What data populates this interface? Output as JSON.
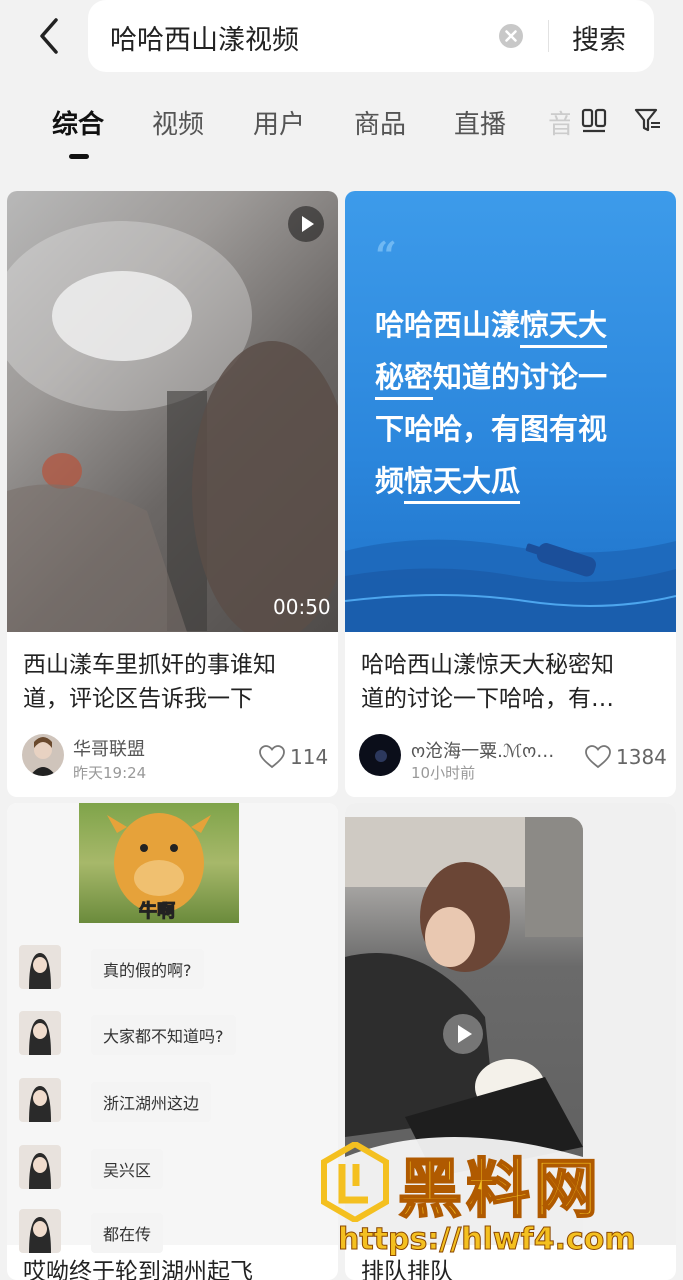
{
  "search": {
    "query": "哈哈西山漾视频",
    "button": "搜索"
  },
  "tabs": [
    "综合",
    "视频",
    "用户",
    "商品",
    "直播",
    "音"
  ],
  "cards": [
    {
      "title": "西山漾车里抓奸的事谁知道，评论区告诉我一下",
      "title_l1": "西山漾车里抓奸的事谁知",
      "title_l2": "道，评论区告诉我一下",
      "author": "华哥联盟",
      "time": "昨天19:24",
      "likes": "114",
      "duration": "00:50"
    },
    {
      "title_l1": "哈哈西山漾惊天大秘密知",
      "title_l2": "道的讨论一下哈哈，有…",
      "author": "ო沧海一粟.ℳო…",
      "time": "10小时前",
      "likes": "1384",
      "cover_lines": {
        "p1": "哈哈西山漾",
        "h1": "惊天大",
        "h2": "秘密",
        "p2": "知道的讨论一",
        "p3": "下哈哈，有图有视",
        "p4": "频",
        "h3": "惊天大瓜"
      }
    },
    {
      "title_l1": "哎呦终于轮到湖州起飞",
      "meme_caption": "牛啊",
      "chats": [
        "真的假的啊?",
        "大家都不知道吗?",
        "浙江湖州这边",
        "吴兴区",
        "都在传"
      ]
    },
    {
      "title_l1": "排队排队"
    }
  ],
  "watermark": {
    "name": "黑料网",
    "url": "https://hlwf4.com"
  },
  "colors": {
    "accent": "#111111",
    "blue_cover": "#2f8fe0",
    "watermark": "#f4c020"
  }
}
